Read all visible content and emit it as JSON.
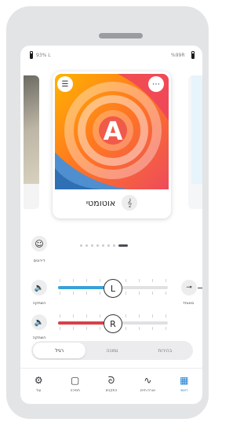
{
  "status": {
    "left_text": "93% L",
    "right_text": "%99R"
  },
  "program": {
    "letter": "A",
    "name": "אוטומטי",
    "settings_icon": "sliders-icon",
    "more_icon": "ellipsis-icon",
    "program_icon": "ear-sound-icon"
  },
  "dots": {
    "count": 8,
    "active_index": 7
  },
  "left_controls": {
    "smile_label": "דירוגים",
    "mute_label_1": "השתקה",
    "mute_label_2": "השתקה"
  },
  "sliders": {
    "left": {
      "letter": "L",
      "value": 0.5,
      "color": "#3aa0d9"
    },
    "right": {
      "letter": "R",
      "value": 0.5,
      "color": "#d8404a"
    }
  },
  "link": {
    "label": "מאוחד"
  },
  "segmented": {
    "options": [
      "רגיל",
      "נמוכה",
      "בהירות"
    ],
    "active_index": 0
  },
  "nav": {
    "items": [
      {
        "label": "עוד",
        "icon": "gear-icon"
      },
      {
        "label": "תמיכה",
        "icon": "chat-icon"
      },
      {
        "label": "התקנים",
        "icon": "hearing-aid-icon"
      },
      {
        "label": "אורח חיים",
        "icon": "activity-icon"
      },
      {
        "label": "ראשי",
        "icon": "grid-icon"
      }
    ],
    "active_index": 4
  },
  "colors": {
    "accent": "#1f7fd0",
    "left_channel": "#3aa0d9",
    "right_channel": "#d8404a"
  }
}
